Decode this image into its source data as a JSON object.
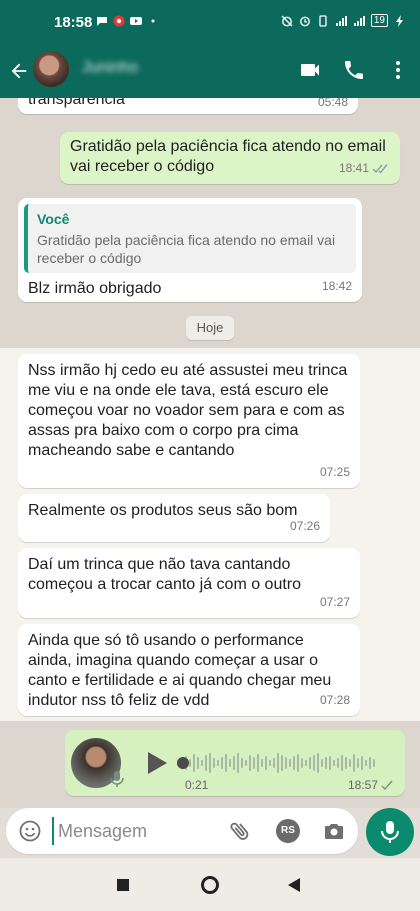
{
  "status_bar": {
    "time": "18:58",
    "battery": "19"
  },
  "header": {
    "contact_name": "Juninho"
  },
  "messages": [
    {
      "id": "m0",
      "direction": "in",
      "text": "transparência",
      "time": "05:48"
    },
    {
      "id": "m1",
      "direction": "out",
      "text": "Gratidão pela paciência fica atendo no email vai receber o código",
      "time": "18:41",
      "status": "read"
    },
    {
      "id": "m2",
      "direction": "in",
      "quote_author": "Você",
      "quote_text": "Gratidão pela paciência fica atendo no email vai receber o código",
      "text": "Blz irmão obrigado",
      "time": "18:42"
    },
    {
      "id": "m3",
      "direction": "in",
      "text": "Nss irmão hj cedo eu até assustei meu trinca me viu e na onde ele tava, está escuro ele começou voar no voador sem para e com as assas pra baixo com o corpo pra cima macheando sabe e cantando",
      "time": "07:25"
    },
    {
      "id": "m4",
      "direction": "in",
      "text": "Realmente os produtos seus são bom",
      "time": "07:26"
    },
    {
      "id": "m5",
      "direction": "in",
      "text": "Daí um trinca que não tava cantando começou a trocar canto já com o outro",
      "time": "07:27"
    },
    {
      "id": "m6",
      "direction": "in",
      "text": "Ainda que só tô usando o performance ainda, imagina quando começar a usar o canto e fertilidade e ai quando chegar meu indutor nss tô feliz de vdd",
      "time": "07:28"
    }
  ],
  "day_separator": "Hoje",
  "voice_message": {
    "duration": "0:21",
    "time": "18:57",
    "status": "sent"
  },
  "composer": {
    "placeholder": "Mensagem",
    "rs_badge": "RS"
  },
  "colors": {
    "header": "#0b6a5b",
    "outgoing_bubble": "#dcf5c7",
    "accent": "#0b8a6e"
  }
}
